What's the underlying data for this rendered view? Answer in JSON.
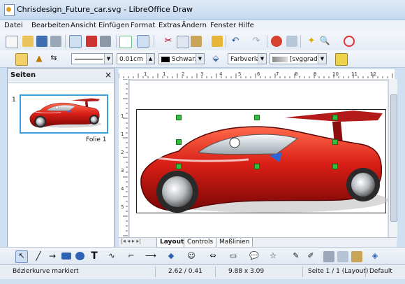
{
  "window": {
    "title": "Chrisdesign_Future_car.svg - LibreOffice Draw"
  },
  "menu": [
    "Datei",
    "Bearbeiten",
    "Ansicht",
    "Einfügen",
    "Format",
    "Extras",
    "Ändern",
    "Fenster",
    "Hilfe"
  ],
  "toolbar2": {
    "line_width": "0.01cm",
    "line_color": "Schwarz",
    "fill_type": "Farbverlau",
    "fill_name": "[svggradi"
  },
  "side_panel": {
    "title": "Seiten",
    "close": "×",
    "slide_number": "1",
    "slide_label": "Folie 1"
  },
  "ruler_h": [
    "1",
    "1",
    "2",
    "3",
    "4",
    "5",
    "6",
    "7",
    "8",
    "9",
    "10",
    "11",
    "12"
  ],
  "ruler_v": [
    "1",
    "1",
    "2",
    "3",
    "4",
    "5"
  ],
  "tabs": [
    "Layout",
    "Controls",
    "Maßlinien"
  ],
  "status": {
    "message": "Bézierkurve markiert",
    "position": "2.62 / 0.41",
    "size": "9.88 x 3.09",
    "page": "Seite 1 / 1 (Layout)",
    "layout": "Default"
  },
  "colors": {
    "car_red": "#d81e16",
    "selection": "#2fbf3a",
    "accent": "#3a6fb6"
  }
}
